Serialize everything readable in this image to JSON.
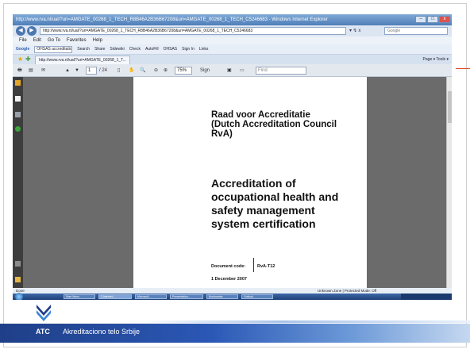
{
  "window": {
    "title": "http://www.rva.nl/ual/?uri=AMGATE_00268_1_TECH_R8B46A2B36B67208&uri=AMGATE_00268_1_TECH_C5246683 - Windows Internet Explorer",
    "min_glyph": "–",
    "max_glyph": "□",
    "close_glyph": "x"
  },
  "address_bar": {
    "url": "http://www.rva.nl/ual/?uri=AMGATE_00268_1_TECH_R8B46A2B36B67208&uri=AMGATE_00268_1_TECH_C5246683",
    "extra": "▾ ↯ x",
    "search_placeholder": "Google"
  },
  "menu": [
    "File",
    "Edit",
    "Go To",
    "Favorites",
    "Help"
  ],
  "google_toolbar": {
    "brand": "Google",
    "search_value": "OHSAS accreditation AS",
    "items": [
      "Search",
      "Share",
      "Sidewiki",
      "Check",
      "AutoFill",
      "OHSAS",
      "Sign In",
      "Links"
    ]
  },
  "tab": {
    "label": "http://www.rva.nl/ual/?uri=AMGATE_00268_1_T...",
    "right": "Page ▾  Tools ▾"
  },
  "pdf_toolbar": {
    "page_current": "1",
    "page_total": "/ 24",
    "zoom": "75%",
    "sign_label": "Sign",
    "find_placeholder": "Find"
  },
  "document": {
    "org_name": "Raad voor Accreditatie\n(Dutch Accreditation Council\nRvA)",
    "title": "Accreditation of\noccupational health and\nsafety management\nsystem certification",
    "code_label": "Document code:",
    "code_value": "RvA-T12",
    "date": "1 December 2007"
  },
  "status_bar": {
    "left": "Done",
    "right": "Unknown Zone | Protected Mode: Off"
  },
  "taskbar": {
    "tasks": [
      "Start Menu",
      "2 Internet...",
      "Microsoft...",
      "Presentation...",
      "Bookmarks",
      "Outlook"
    ]
  },
  "footer": {
    "abbr": "ATC",
    "org": "Akreditaciono telo Srbije"
  },
  "colors": {
    "footer_dark": "#1f3f88",
    "footer_light": "#c6d8f0",
    "accent_line": "#e0442a"
  }
}
